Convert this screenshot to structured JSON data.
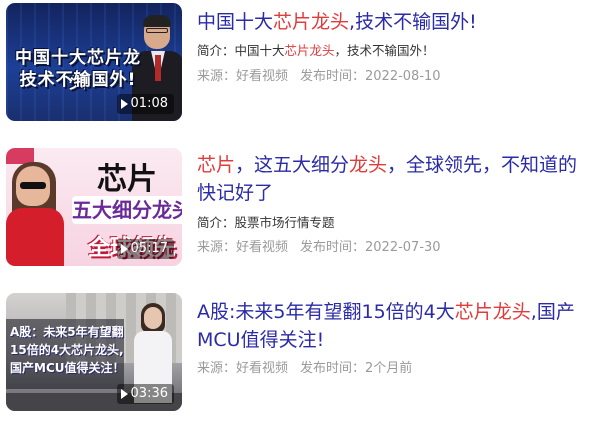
{
  "results": [
    {
      "title_parts": [
        "中国十大",
        "芯片龙头",
        ",技术不输国外!"
      ],
      "snippet_parts": [
        "简介：中国十大",
        "芯片龙头",
        "，技术不输国外！"
      ],
      "source": "来源：好看视频",
      "date": "发布时间：2022-08-10",
      "duration": "01:08",
      "thumb_caption": [
        "中国十大芯片龙头",
        "技术不输国外!"
      ]
    },
    {
      "title_parts": [
        "芯片",
        "，这五大细分",
        "龙头",
        "，全球领先，不知道的快记好了"
      ],
      "snippet": "简介：股票市场行情专题",
      "source": "来源：好看视频",
      "date": "发布时间：2022-07-30",
      "duration": "05:17",
      "thumb_caption": [
        "芯片",
        "五大细分龙头",
        "全球领先"
      ]
    },
    {
      "title_parts": [
        "A股:未来5年有望翻15倍的4大",
        "芯片龙头",
        ",国产MCU值得关注!"
      ],
      "source": "来源：好看视频",
      "date": "发布时间：2个月前",
      "duration": "03:36",
      "thumb_caption": [
        "A股：未来5年有望翻",
        "15倍的4大芯片龙头,",
        "国产MCU值得关注！"
      ]
    }
  ],
  "colors": {
    "title": "#2b2ba8",
    "highlight": "#e13c3c",
    "meta": "#9a9a9a"
  }
}
